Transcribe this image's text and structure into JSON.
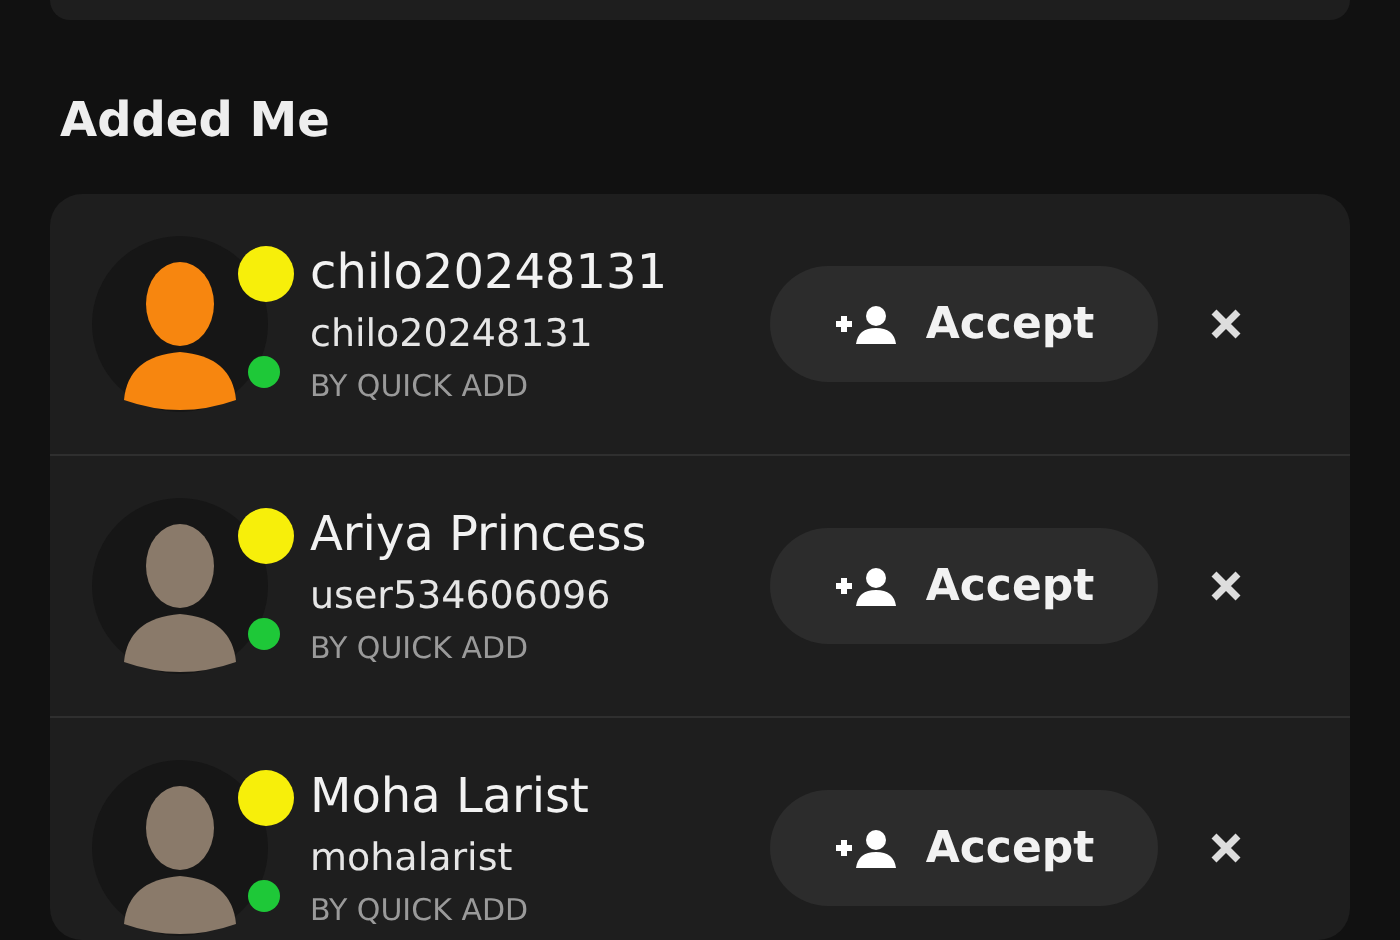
{
  "section_title": "Added Me",
  "requests": [
    {
      "display_name": "chilo20248131",
      "username": "chilo20248131",
      "source": "BY QUICK ADD",
      "action": "Accept",
      "kind": "silhouette"
    },
    {
      "display_name": "Ariya Princess",
      "username": "user534606096",
      "source": "BY QUICK ADD",
      "action": "Accept",
      "kind": "character"
    },
    {
      "display_name": "Moha Larist",
      "username": "mohalarist",
      "source": "BY QUICK ADD",
      "action": "Accept",
      "kind": "character"
    }
  ]
}
